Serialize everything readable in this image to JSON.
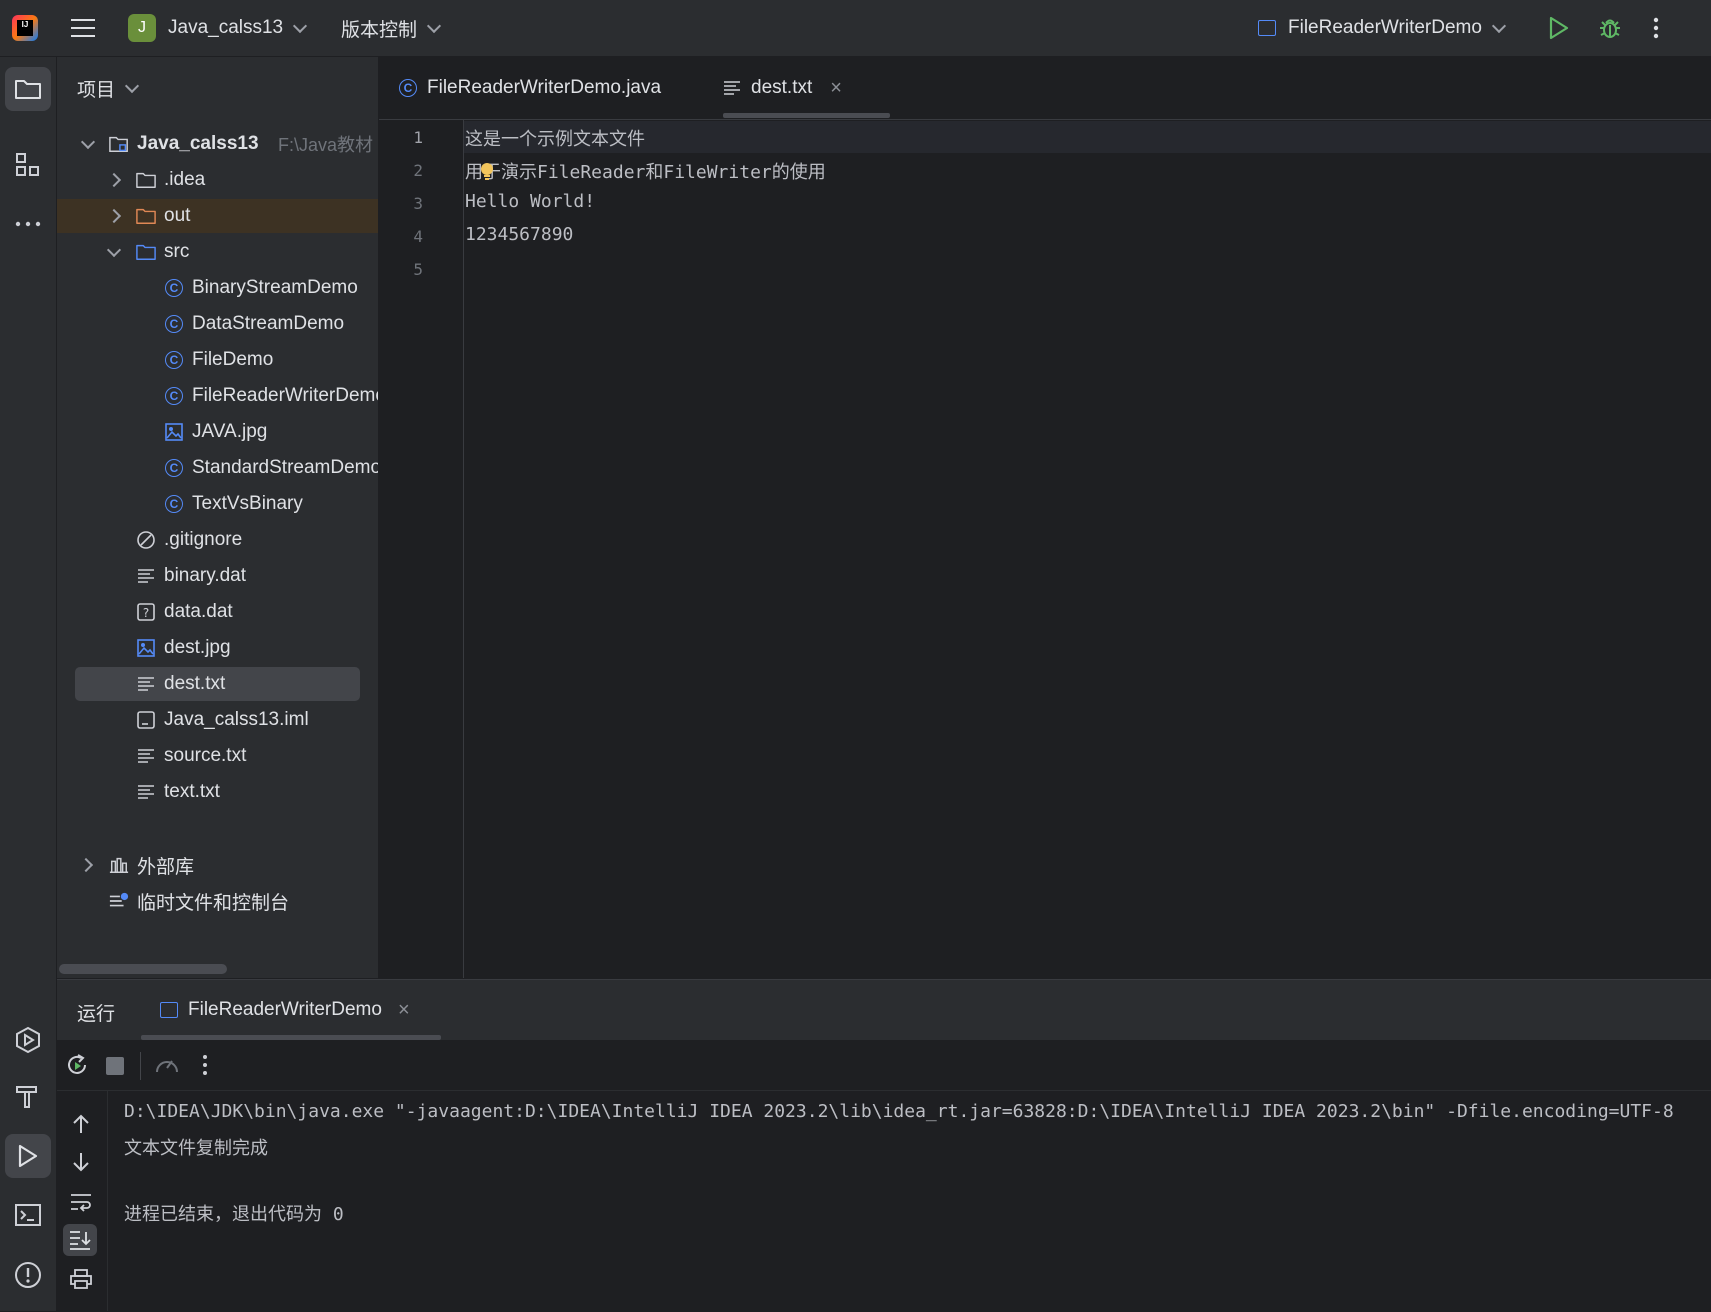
{
  "topbar": {
    "project_badge": "J",
    "project_name": "Java_calss13",
    "vcs_label": "版本控制",
    "run_config": "FileReaderWriterDemo"
  },
  "project_panel": {
    "title": "项目",
    "root_name": "Java_calss13",
    "root_path": "F:\\Java教材",
    "items": [
      {
        "label": ".idea",
        "type": "folder"
      },
      {
        "label": "out",
        "type": "folder-excluded"
      },
      {
        "label": "src",
        "type": "folder-source"
      },
      {
        "label": "BinaryStreamDemo",
        "type": "class"
      },
      {
        "label": "DataStreamDemo",
        "type": "class"
      },
      {
        "label": "FileDemo",
        "type": "class"
      },
      {
        "label": "FileReaderWriterDemo",
        "type": "class"
      },
      {
        "label": "JAVA.jpg",
        "type": "image"
      },
      {
        "label": "StandardStreamDemo",
        "type": "class"
      },
      {
        "label": "TextVsBinary",
        "type": "class"
      },
      {
        "label": ".gitignore",
        "type": "ignore"
      },
      {
        "label": "binary.dat",
        "type": "text"
      },
      {
        "label": "data.dat",
        "type": "unknown"
      },
      {
        "label": "dest.jpg",
        "type": "image"
      },
      {
        "label": "dest.txt",
        "type": "text"
      },
      {
        "label": "Java_calss13.iml",
        "type": "module"
      },
      {
        "label": "source.txt",
        "type": "text"
      },
      {
        "label": "text.txt",
        "type": "text"
      }
    ],
    "external_libs": "外部库",
    "scratches": "临时文件和控制台"
  },
  "editor": {
    "tabs": [
      {
        "label": "FileReaderWriterDemo.java",
        "active": false
      },
      {
        "label": "dest.txt",
        "active": true
      }
    ],
    "line_numbers": [
      "1",
      "2",
      "3",
      "4",
      "5"
    ],
    "lines": [
      "这是一个示例文本文件",
      "用于演示FileReader和FileWriter的使用",
      "Hello World!",
      "1234567890",
      ""
    ]
  },
  "run_panel": {
    "title": "运行",
    "tab_label": "FileReaderWriterDemo",
    "console_lines": [
      "D:\\IDEA\\JDK\\bin\\java.exe \"-javaagent:D:\\IDEA\\IntelliJ IDEA 2023.2\\lib\\idea_rt.jar=63828:D:\\IDEA\\IntelliJ IDEA 2023.2\\bin\" -Dfile.encoding=UTF-8",
      "文本文件复制完成",
      "",
      "进程已结束，退出代码为 0"
    ]
  },
  "colors": {
    "accent": "#548af7",
    "run_green": "#5fb865",
    "badge_green": "#6a8f3b"
  }
}
